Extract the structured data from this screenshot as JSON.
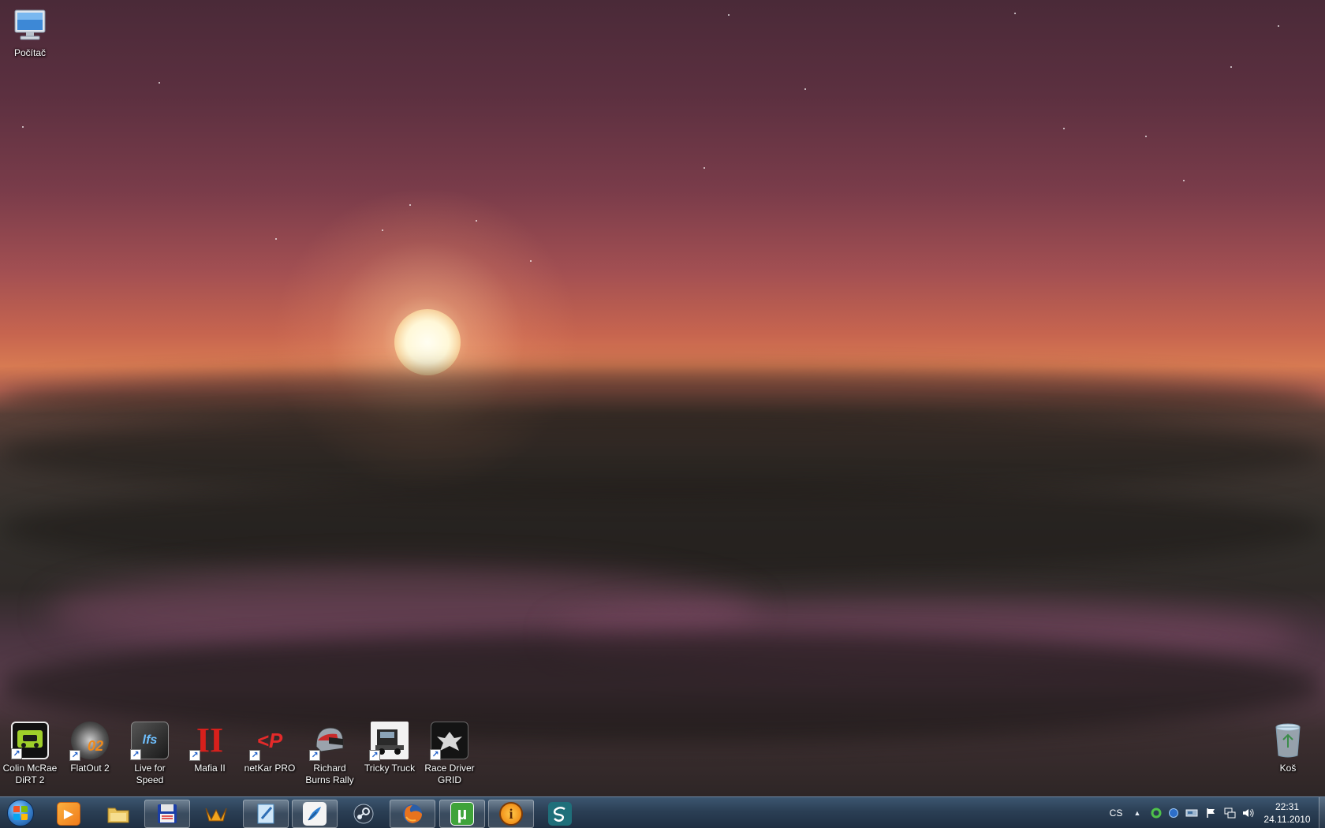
{
  "desktop": {
    "top_icons": [
      {
        "label": "Počítač",
        "icon": "computer-icon"
      }
    ],
    "bottom_icons": [
      {
        "label": "Colin McRae\nDiRT 2",
        "icon": "dirt2-icon"
      },
      {
        "label": "FlatOut 2",
        "icon": "flatout2-icon",
        "badge": "02"
      },
      {
        "label": "Live for\nSpeed",
        "icon": "lfs-icon",
        "badge": "lfs"
      },
      {
        "label": "Mafia II",
        "icon": "mafia2-icon",
        "badge": "II"
      },
      {
        "label": "netKar PRO",
        "icon": "netkar-icon",
        "badge": "<P"
      },
      {
        "label": "Richard\nBurns Rally",
        "icon": "rbr-helmet-icon"
      },
      {
        "label": "Tricky Truck",
        "icon": "truck-icon"
      },
      {
        "label": "Race Driver\nGRID",
        "icon": "grid-icon"
      }
    ],
    "recycle_bin": {
      "label": "Koš",
      "icon": "recycle-bin-icon"
    }
  },
  "taskbar": {
    "start": {
      "icon": "windows-start-icon"
    },
    "buttons": [
      {
        "name": "media-player",
        "icon": "media-player-icon",
        "open": false
      },
      {
        "name": "explorer",
        "icon": "folder-icon",
        "open": false
      },
      {
        "name": "save-app",
        "icon": "floppy-disk-icon",
        "open": true
      },
      {
        "name": "winamp",
        "icon": "winamp-icon",
        "open": false
      },
      {
        "name": "notepad",
        "icon": "notepad-icon",
        "open": true
      },
      {
        "name": "pen-app",
        "icon": "feather-pen-icon",
        "open": true
      },
      {
        "name": "steam",
        "icon": "steam-icon",
        "open": false
      },
      {
        "name": "firefox",
        "icon": "firefox-icon",
        "open": true
      },
      {
        "name": "utorrent",
        "icon": "utorrent-icon",
        "open": true,
        "glyph": "µ"
      },
      {
        "name": "info-app",
        "icon": "info-icon",
        "open": true,
        "glyph": "i"
      },
      {
        "name": "app-s",
        "icon": "spiral-s-icon",
        "open": false
      }
    ],
    "tray": {
      "language": "CS",
      "icons": [
        "show-hidden-icon",
        "green-ring-icon",
        "blue-dot-icon",
        "network-adapter-icon",
        "action-center-flag-icon",
        "network-icon",
        "volume-icon"
      ],
      "time": "22:31",
      "date": "24.11.2010"
    }
  }
}
